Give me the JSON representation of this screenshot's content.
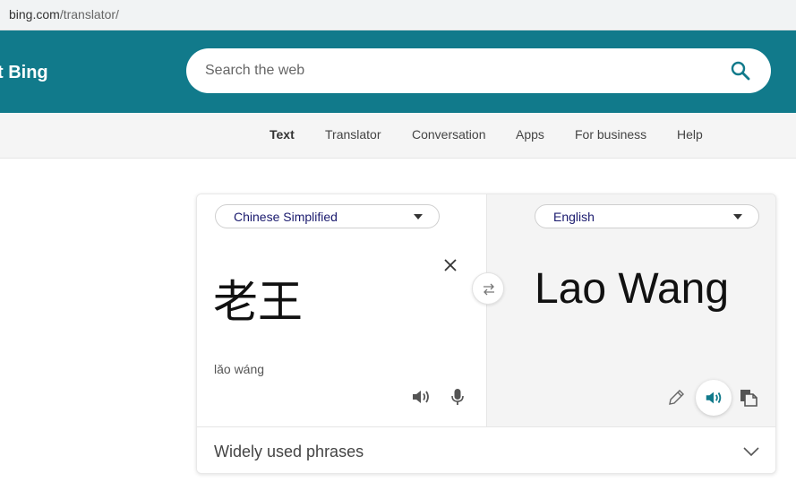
{
  "browser": {
    "url_domain": "bing.com",
    "url_path": "/translator/"
  },
  "header": {
    "brand": "t Bing",
    "search_placeholder": "Search the web",
    "search_icon": "search-icon",
    "accent_color": "#117a8b"
  },
  "nav": {
    "items": [
      {
        "label": "Text",
        "active": true
      },
      {
        "label": "Translator",
        "active": false
      },
      {
        "label": "Conversation",
        "active": false
      },
      {
        "label": "Apps",
        "active": false
      },
      {
        "label": "For business",
        "active": false
      },
      {
        "label": "Help",
        "active": false
      }
    ]
  },
  "translator": {
    "source_language": "Chinese Simplified",
    "target_language": "English",
    "source_text": "老王",
    "pinyin": "lǎo wáng",
    "target_text": "Lao Wang",
    "icons": {
      "clear": "close-icon",
      "swap": "swap-icon",
      "source_speak": "speaker-icon",
      "source_mic": "microphone-icon",
      "edit": "pencil-icon",
      "target_speak": "speaker-icon",
      "copy": "copy-icon"
    },
    "active_speaker_color": "#117a8b"
  },
  "phrases": {
    "label": "Widely used phrases",
    "icon": "chevron-down-icon"
  }
}
